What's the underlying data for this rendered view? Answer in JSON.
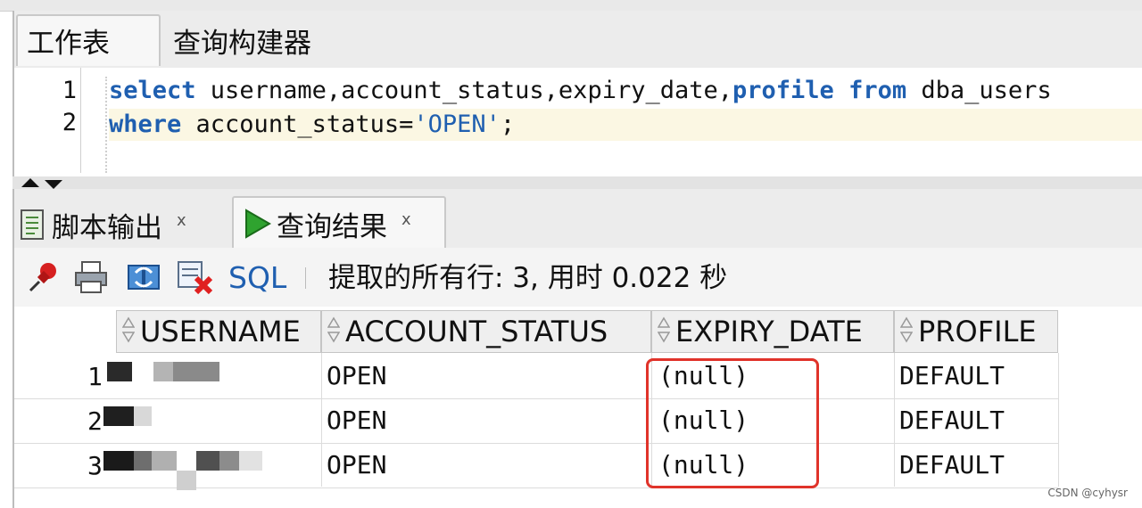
{
  "worksheet_tabs": {
    "worksheet": "工作表",
    "query_builder": "查询构建器"
  },
  "editor": {
    "line_numbers": [
      "1",
      "2"
    ],
    "line1": {
      "kw1": "select",
      "t1": " username,account_status,expiry_date,",
      "kw2": "profile",
      "sp": " ",
      "kw3": "from",
      "t2": " dba_users"
    },
    "line2": {
      "kw1": "where",
      "t1": " account_status=",
      "str": "'OPEN'",
      "t2": ";"
    }
  },
  "output_tabs": {
    "script_output": "脚本输出",
    "query_result": "查询结果",
    "close": "x"
  },
  "toolbar": {
    "sql_label": "SQL",
    "separator": "|",
    "status": "提取的所有行: 3, 用时 0.022 秒"
  },
  "grid": {
    "columns": [
      "USERNAME",
      "ACCOUNT_STATUS",
      "EXPIRY_DATE",
      "PROFILE"
    ],
    "rows": [
      {
        "num": "1",
        "account_status": "OPEN",
        "expiry_date": "(null)",
        "profile": "DEFAULT"
      },
      {
        "num": "2",
        "account_status": "OPEN",
        "expiry_date": "(null)",
        "profile": "DEFAULT"
      },
      {
        "num": "3",
        "account_status": "OPEN",
        "expiry_date": "(null)",
        "profile": "DEFAULT"
      }
    ]
  },
  "colors": {
    "keyword": "#1f5fb0",
    "highlight": "#e0332a"
  },
  "watermark": "CSDN @cyhysr"
}
